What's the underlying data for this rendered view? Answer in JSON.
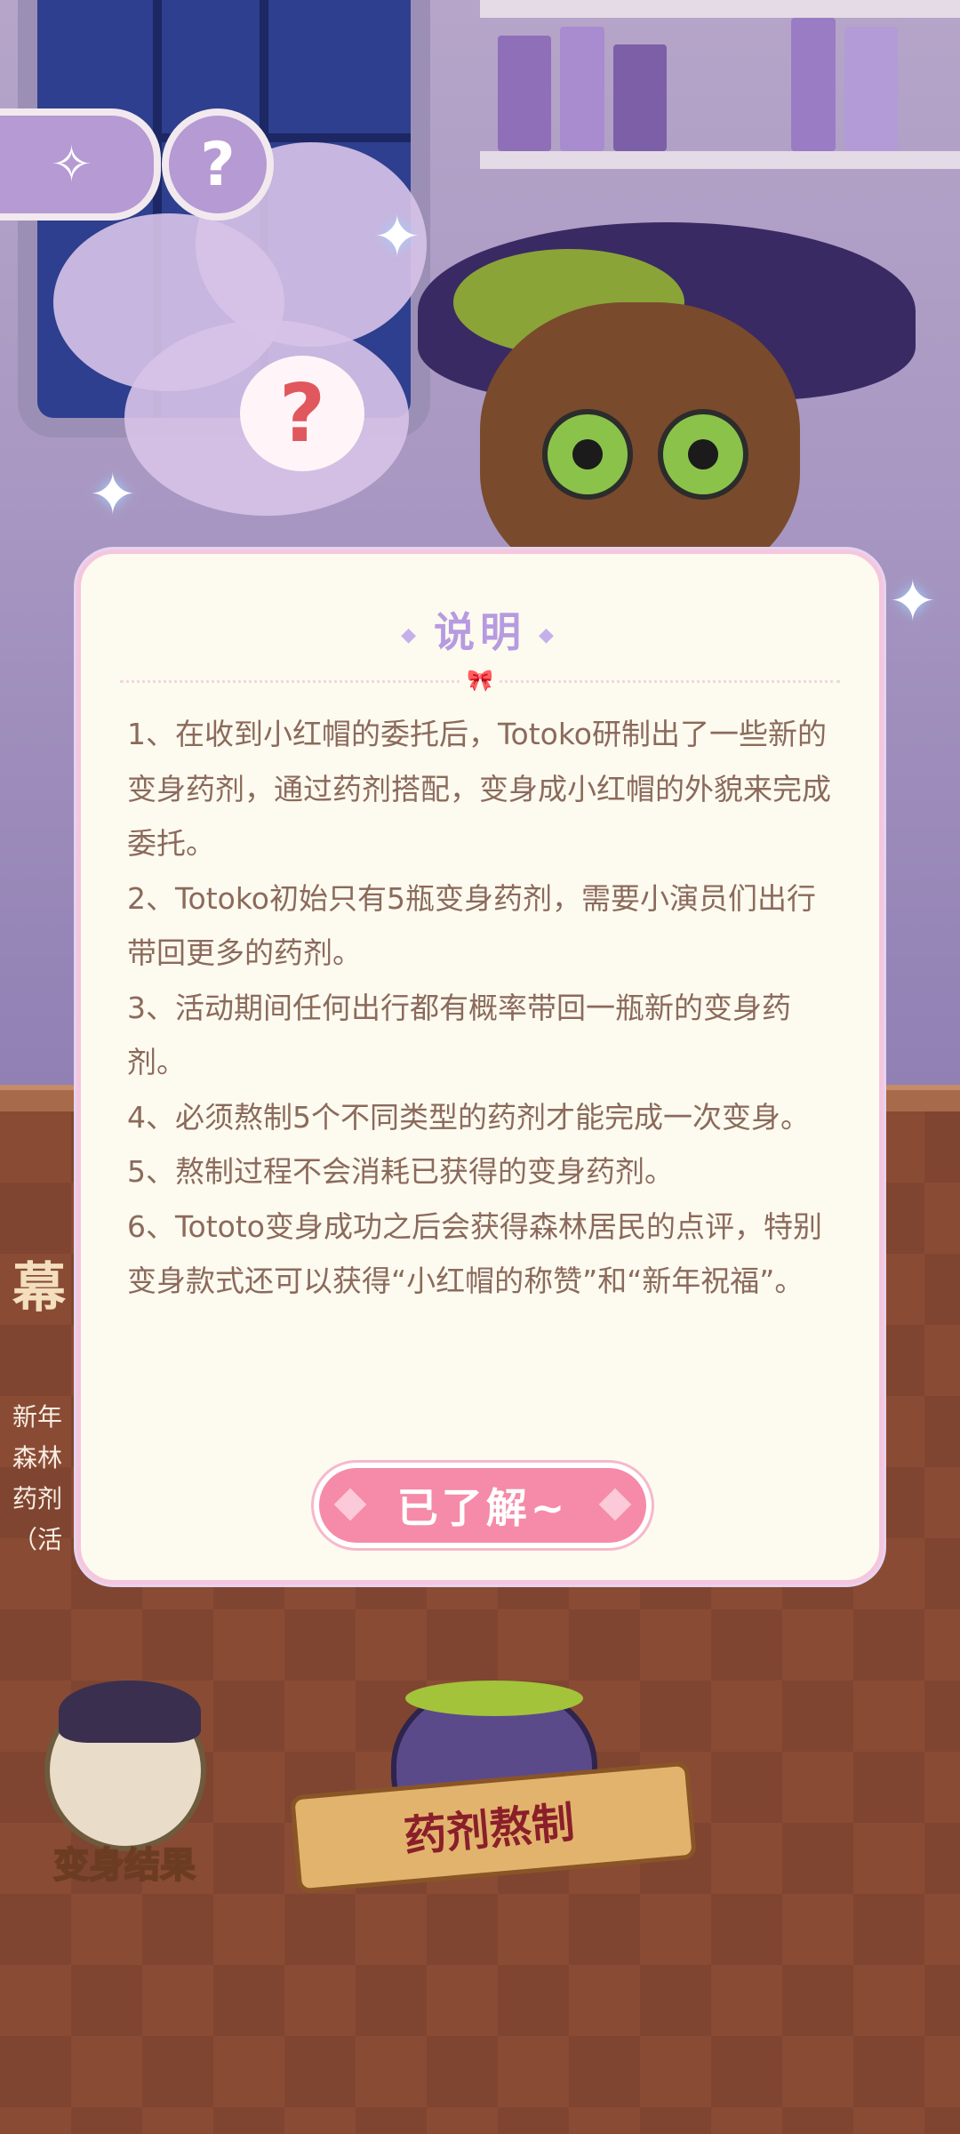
{
  "background": {
    "help_button_symbol": "?",
    "thought_bubble_symbol": "?",
    "partial_texts": [
      "幕",
      "新年",
      "森林",
      "药剂",
      "（活"
    ],
    "result_button_label": "变身结果",
    "brew_button_label": "药剂熬制"
  },
  "modal": {
    "title": "说明",
    "rules": [
      "1、在收到小红帽的委托后，Totoko研制出了一些新的变身药剂，通过药剂搭配，变身成小红帽的外貌来完成委托。",
      "2、Totoko初始只有5瓶变身药剂，需要小演员们出行带回更多的药剂。",
      "3、活动期间任何出行都有概率带回一瓶新的变身药剂。",
      "4、必须熬制5个不同类型的药剂才能完成一次变身。",
      "5、熬制过程不会消耗已获得的变身药剂。",
      "6、Tototo变身成功之后会获得森林居民的点评，特别变身款式还可以获得“小红帽的称赞”和“新年祝福”。"
    ],
    "confirm_label": "已了解~"
  },
  "colors": {
    "modal_bg": "#fdfbef",
    "title": "#b79be0",
    "text": "#8b6a5c",
    "button": "#f58ba8"
  }
}
